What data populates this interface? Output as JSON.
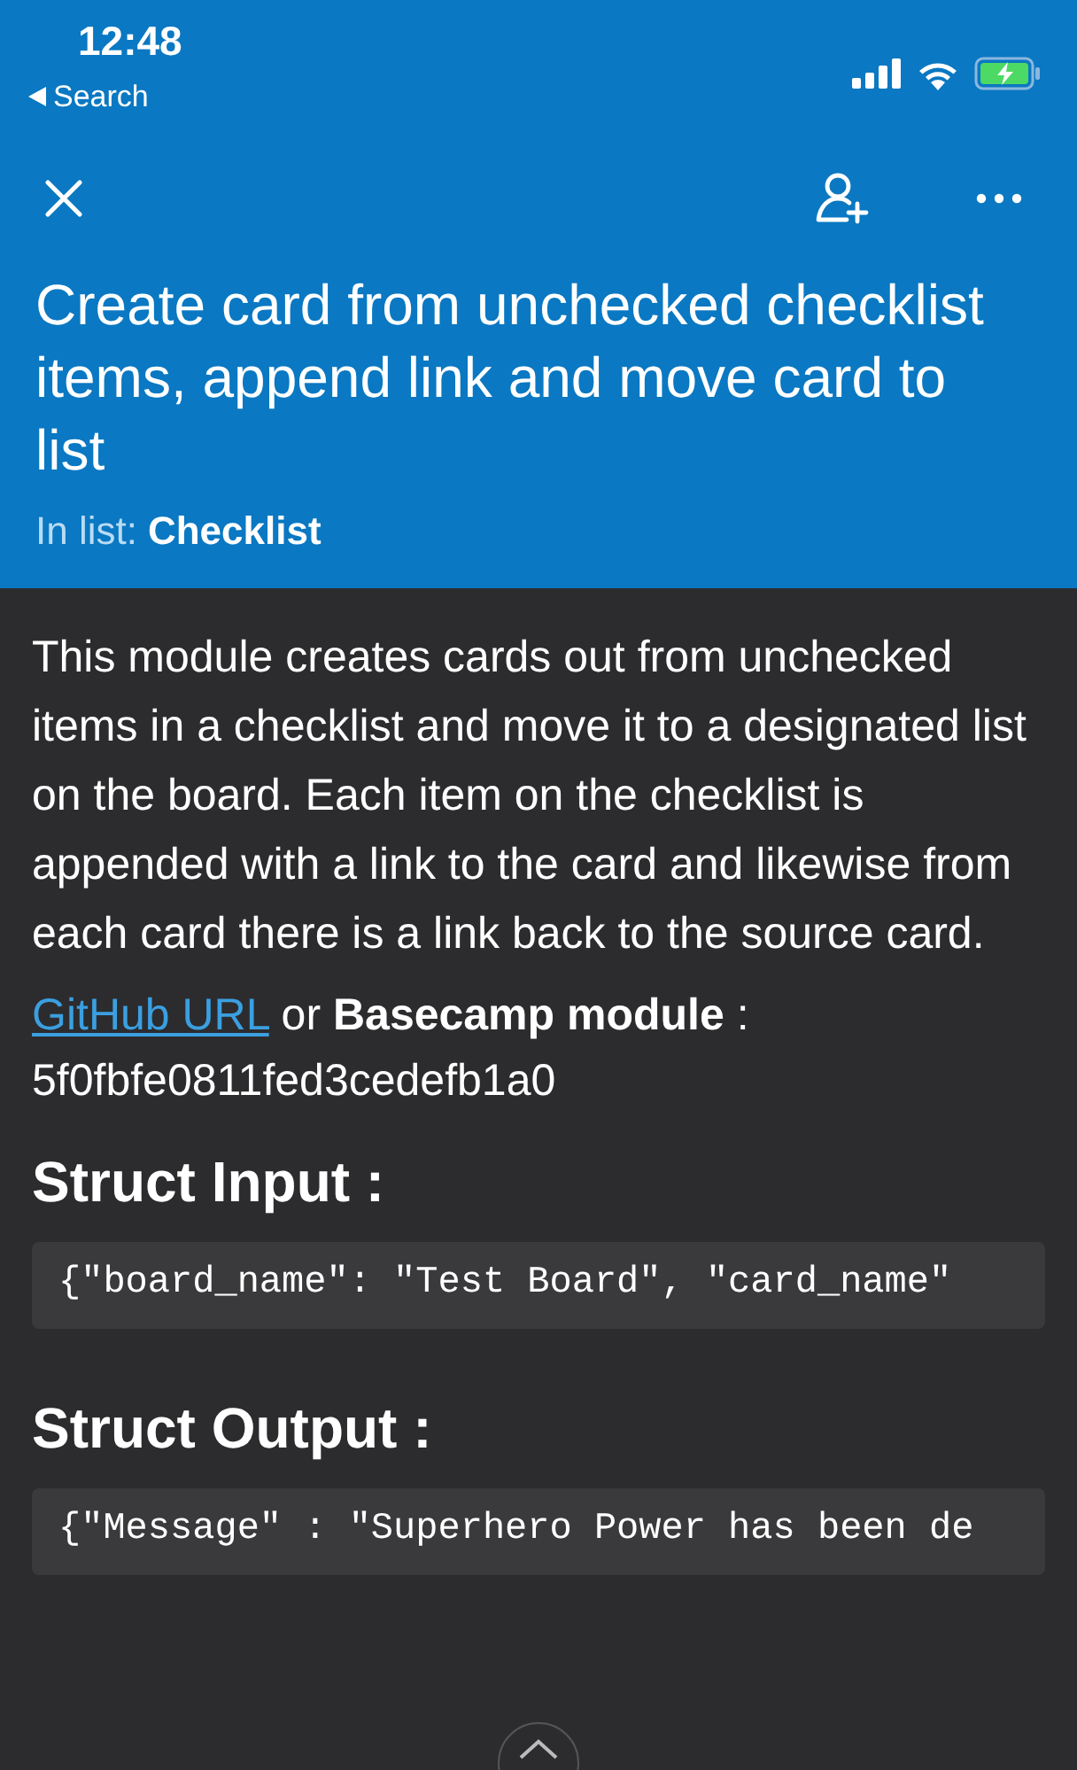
{
  "status_bar": {
    "time": "12:48",
    "back_label": "Search",
    "charging": true
  },
  "header": {
    "title": "Create card from unchecked checklist items, append link and move card to list",
    "list_label": "In list:",
    "list_name": "Checklist"
  },
  "description": "This module creates cards out from unchecked items in a checklist and move it to a designated list on the board. Each item on the checklist is appended with a link to the card and likewise from each card there is a link back to the source card.",
  "source": {
    "link": "GitHub URL",
    "text": "or **Basecamp module** : 5f0fbfe0811fed3cedefb1a0"
  },
  "sections": [
    {
      "heading": "Struct Input :",
      "code": "{\"board_name\": \"Test Board\", \"card_name\""
    },
    {
      "heading": "Struct Output :",
      "code": "{\"Message\" : \"Superhero Power has been de"
    }
  ]
}
